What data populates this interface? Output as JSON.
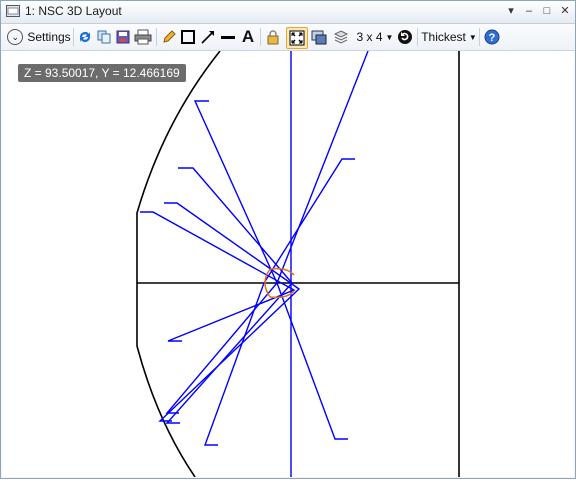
{
  "window": {
    "title": "1: NSC 3D Layout"
  },
  "title_controls": [
    {
      "name": "dropdown-icon",
      "glyph": "▾"
    },
    {
      "name": "minimize-icon",
      "glyph": "–"
    },
    {
      "name": "maximize-icon",
      "glyph": "□"
    },
    {
      "name": "close-icon",
      "glyph": "✕"
    }
  ],
  "toolbar": {
    "settings_label": "Settings",
    "layout_grid_label": "3 x 4",
    "line_thickness_label": "Thickest",
    "icons": [
      "refresh-icon",
      "copy-icon",
      "save-icon",
      "print-icon",
      "pencil-icon",
      "rectangle-icon",
      "arrow-line-icon",
      "line-icon",
      "text-tool-icon",
      "lock-icon",
      "fit-to-window-icon",
      "window-options-icon",
      "layers-icon",
      "rotate-icon",
      "help-icon"
    ],
    "active_tool": "fit-to-window-icon"
  },
  "coordinate_readout": "Z = 93.50017, Y = 12.466169",
  "colors": {
    "rays": "#0000ff",
    "geometry": "#000000",
    "lens": "#e07020",
    "active_tool_border": "#e3a92f"
  }
}
